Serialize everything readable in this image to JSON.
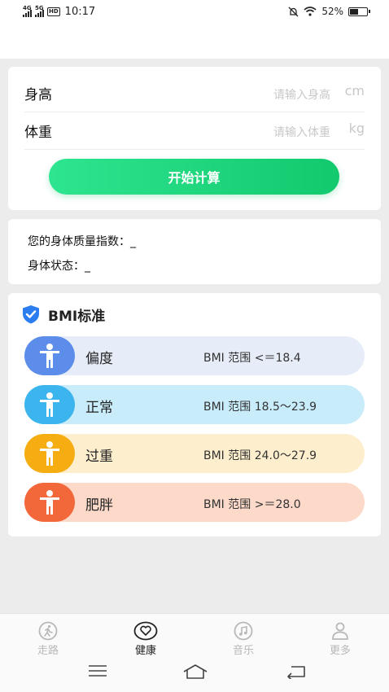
{
  "status_bar": {
    "network_1": "4G",
    "network_2": "5G",
    "hd": "HD",
    "time": "10:17",
    "battery": "52%",
    "battery_level": 0.52
  },
  "form": {
    "height": {
      "label": "身高",
      "placeholder": "请输入身高",
      "unit": "cm"
    },
    "weight": {
      "label": "体重",
      "placeholder": "请输入体重",
      "unit": "kg"
    },
    "calculate_label": "开始计算",
    "accent_color": "#1ed37c"
  },
  "result": {
    "bmi_label": "您的身体质量指数：",
    "bmi_value": "_",
    "state_label": "身体状态：",
    "state_value": "_"
  },
  "bmi_standard": {
    "title": "BMI标准",
    "categories": [
      {
        "name": "偏度",
        "range": "BMI 范围 <＝18.4",
        "icon": "person-icon",
        "color": "#5c8dea",
        "bg": "#e6ecf8"
      },
      {
        "name": "正常",
        "range": "BMI 范围 18.5～23.9",
        "icon": "person-icon",
        "color": "#3cb4ee",
        "bg": "#c9ecfb"
      },
      {
        "name": "过重",
        "range": "BMI 范围 24.0～27.9",
        "icon": "person-icon",
        "color": "#f5ad12",
        "bg": "#fdefcd"
      },
      {
        "name": "肥胖",
        "range": "BMI 范围 >＝28.0",
        "icon": "person-icon",
        "color": "#f2683a",
        "bg": "#fcd9c9"
      }
    ]
  },
  "tabs": [
    {
      "label": "走路",
      "icon": "walk-icon",
      "active": false
    },
    {
      "label": "健康",
      "icon": "heart-icon",
      "active": true
    },
    {
      "label": "音乐",
      "icon": "music-icon",
      "active": false
    },
    {
      "label": "更多",
      "icon": "user-icon",
      "active": false
    }
  ],
  "system_nav": [
    "menu-icon",
    "home-icon",
    "back-icon"
  ]
}
